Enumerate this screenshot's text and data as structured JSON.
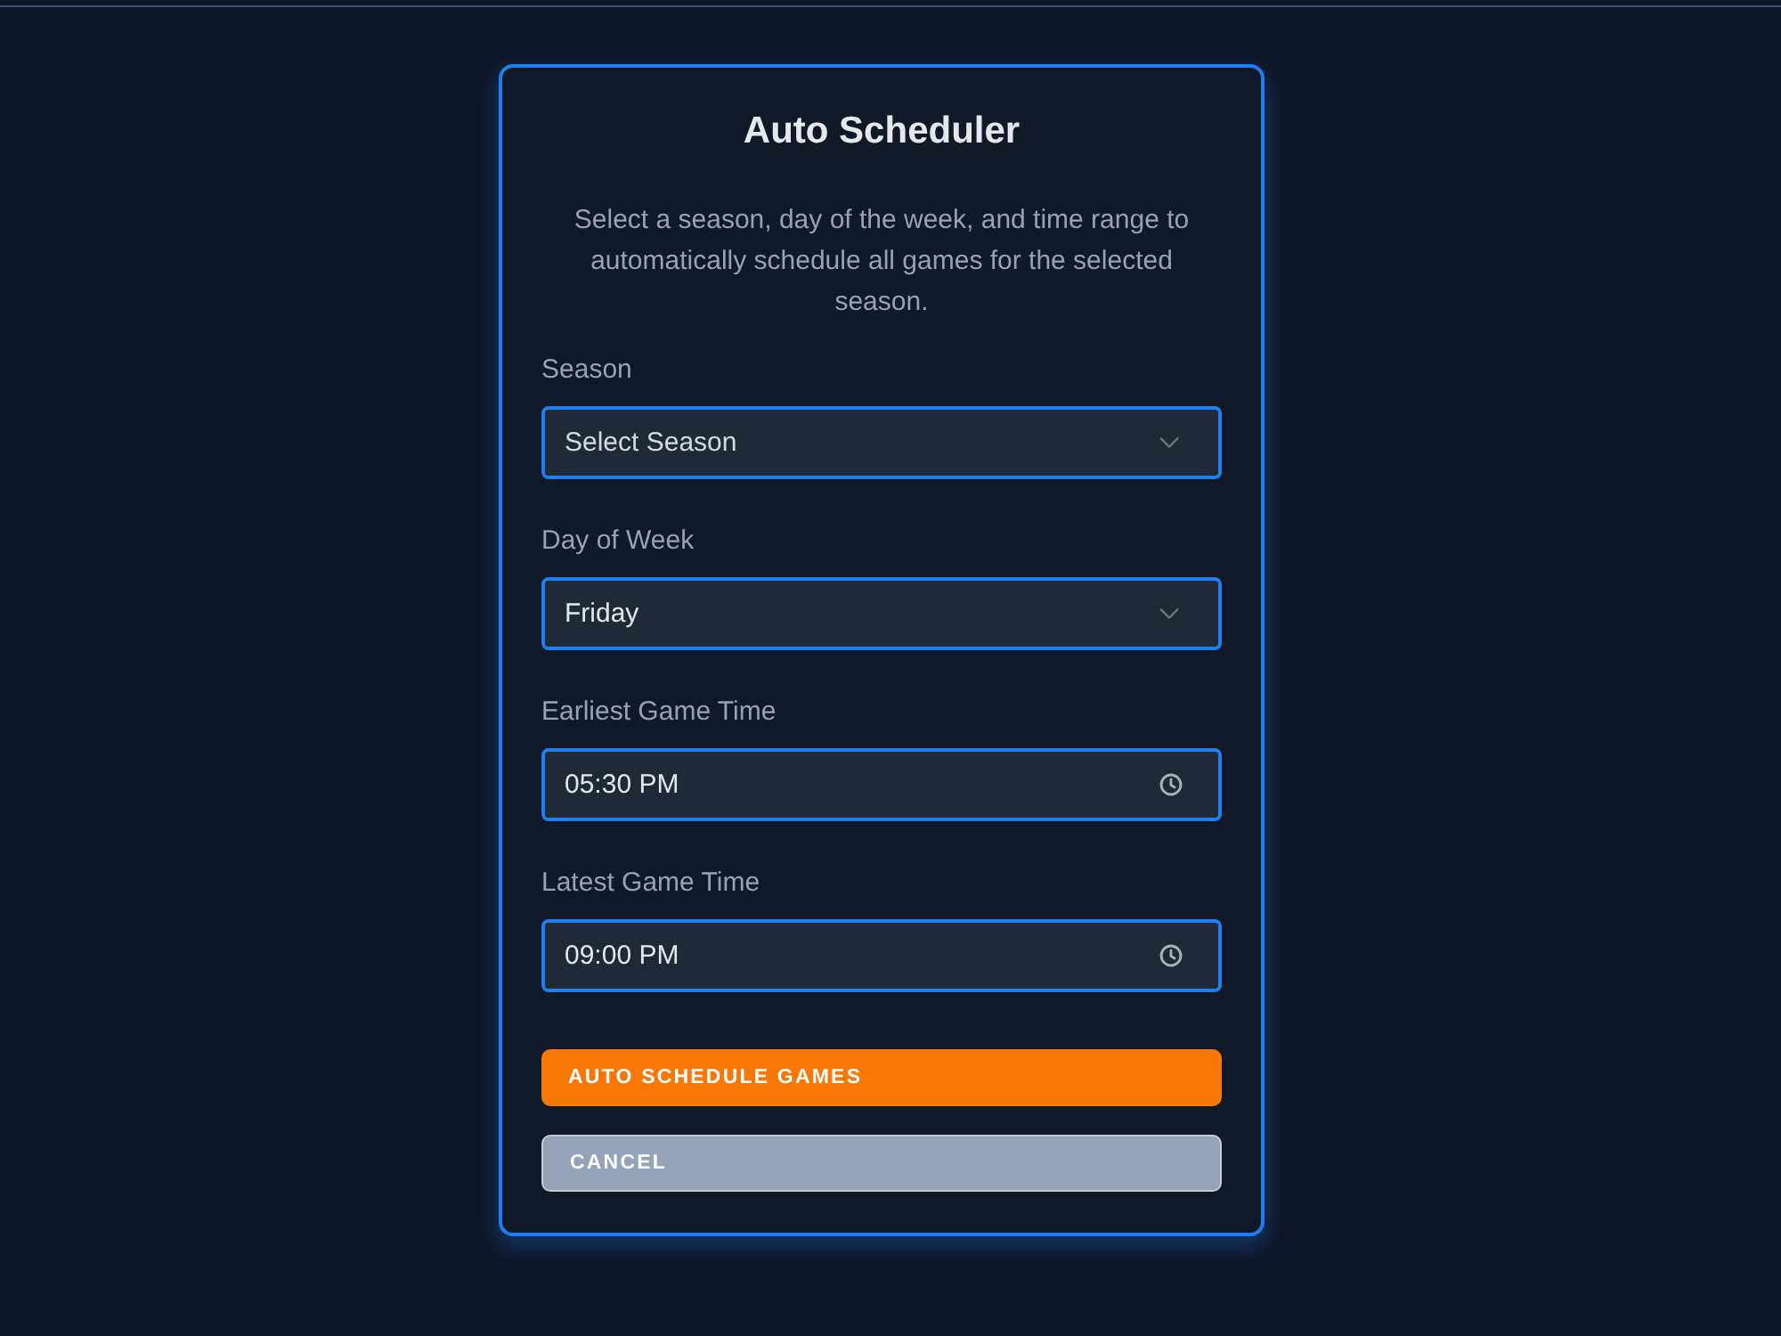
{
  "dialog": {
    "title": "Auto Scheduler",
    "description": "Select a season, day of the week, and time range to automatically schedule all games for the selected season.",
    "fields": [
      {
        "kind": "select",
        "label": "Season",
        "placeholder": "Select Season"
      },
      {
        "kind": "select",
        "label": "Day of Week",
        "value": "Friday"
      },
      {
        "kind": "time",
        "label": "Earliest Game Time",
        "value": "05:30 PM"
      },
      {
        "kind": "time",
        "label": "Latest Game Time",
        "value": "09:00 PM"
      }
    ],
    "buttons": [
      {
        "kind": "primary",
        "label": "AUTO SCHEDULE GAMES"
      },
      {
        "kind": "secondary",
        "label": "CANCEL"
      }
    ]
  }
}
